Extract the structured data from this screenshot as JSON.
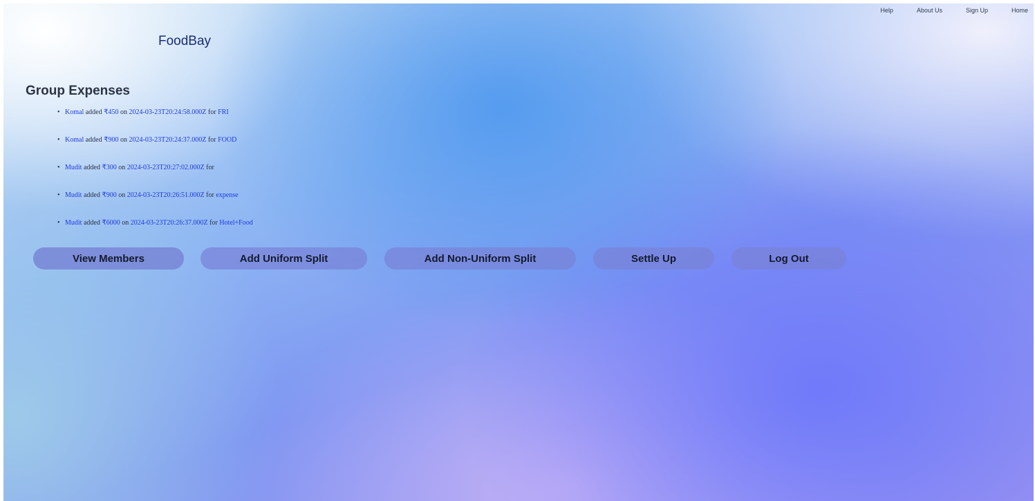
{
  "nav": {
    "items": [
      {
        "label": "Help"
      },
      {
        "label": "About Us"
      },
      {
        "label": "Sign Up"
      },
      {
        "label": "Home"
      }
    ]
  },
  "brand": {
    "name": "FoodBay"
  },
  "expenses": {
    "title": "Group Expenses",
    "items": [
      {
        "user": "Komal",
        "added_text": " added ",
        "amount": "₹450",
        "on_text": " on ",
        "date": "2024-03-23T20:24:58.000Z",
        "for_text": " for ",
        "description": "FRI"
      },
      {
        "user": "Komal",
        "added_text": " added ",
        "amount": "₹900",
        "on_text": " on ",
        "date": "2024-03-23T20:24:37.000Z",
        "for_text": " for ",
        "description": "FOOD"
      },
      {
        "user": "Mudit",
        "added_text": " added ",
        "amount": "₹300",
        "on_text": " on ",
        "date": "2024-03-23T20:27:02.000Z",
        "for_text": " for ",
        "description": ""
      },
      {
        "user": "Mudit",
        "added_text": " added ",
        "amount": "₹900",
        "on_text": " on ",
        "date": "2024-03-23T20:26:51.000Z",
        "for_text": " for ",
        "description": "expense"
      },
      {
        "user": "Mudit",
        "added_text": " added ",
        "amount": "₹6000",
        "on_text": " on ",
        "date": "2024-03-23T20:26:37.000Z",
        "for_text": " for ",
        "description": "Hotel+Food"
      }
    ]
  },
  "actions": {
    "view_members": "View Members",
    "add_uniform_split": "Add Uniform Split",
    "add_non_uniform_split": "Add Non-Uniform Split",
    "settle_up": "Settle Up",
    "log_out": "Log Out"
  },
  "colors": {
    "link": "#1f3adf",
    "brand": "#1a2e75",
    "button_bg": "#7882d7"
  }
}
